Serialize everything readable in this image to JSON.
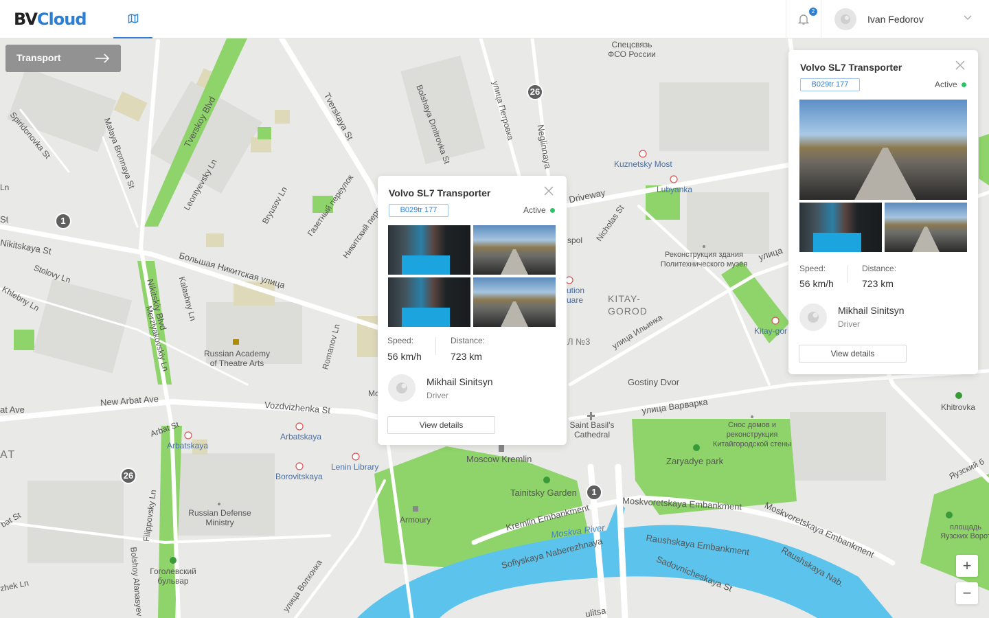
{
  "header": {
    "logo_bv": "BV",
    "logo_cloud": "Cloud",
    "notification_count": "2",
    "user_name": "Ivan Fedorov"
  },
  "transport_button": {
    "label": "Transport"
  },
  "clusters": [
    "26",
    "1",
    "26",
    "1"
  ],
  "map_labels": {
    "tverskoy": "Tverskoy Blvd",
    "tverskaya": "Tverskaya St",
    "bolshaya_dmitrovka": "Bolshaya Dmitrovka St",
    "petrovka": "улица Петровка",
    "neglinnaya": "Neglinnaya",
    "spidironovka": "Spiridonovka St",
    "malaya_bronnaya": "Malaya Bronnaya St",
    "leontyevsky": "Leontyevsky Ln",
    "bryusov": "Bryusov Ln",
    "gazetny": "Газетный переулок",
    "nikitsky_per": "Никитский переулок",
    "nikitskaya": "Nikitskaya St",
    "bolshaya_nikitskaya": "Большая Никитская улица",
    "stolovy": "Stolovy Ln",
    "khlebny": "Khlebny Ln",
    "nikitsky_blvd": "Nikitskiy Blvd",
    "kalashny": "Kalashny Ln",
    "merzlyakovsky": "Merzlyakovskiy Ln",
    "romanov": "Romanov Ln",
    "academy": "Russian Academy of Theatre Arts",
    "new_arbat": "New Arbat Ave",
    "arbat_ave": "at Ave",
    "vozdvizhenka": "Vozdvizhenka St",
    "arbat_st": "Arbat St",
    "arbatskaya1": "Arbatskaya",
    "arbatskaya2": "Arbatskaya",
    "borovitskaya": "Borovitskaya",
    "lenin_library": "Lenin Library",
    "defense": "Russian Defense Ministry",
    "filippovsky": "Filippovsky Ln",
    "gogolevsky": "Гоголевский бульвар",
    "bolshoy_afanasy": "Bolshoy Afanasyev",
    "volkhonka": "улица Волхонка",
    "spetssvyaz": "Спецсвязь ФСО России",
    "kuznetsky": "Kuznetsky Most",
    "lubyanka": "Lubyanka",
    "driveway": "Driveway",
    "nicholas": "Nicholas St",
    "ploshchad": "ution uare",
    "polytech": "Реконструкция здания Политехнического музея",
    "kitay_gorod": "KITAY-GOROD",
    "ilyinka": "улица Ильинка",
    "kitay_gor_station": "Kitay-gor",
    "gostiny": "Gostiny Dvor",
    "varvarka": "улица Варварка",
    "saint_basil": "Saint Basil's Cathedral",
    "snos": "Снос домов и реконструкция Китайгородской стены",
    "zaryadye": "Zaryadye park",
    "kremlin": "Moscow Kremlin",
    "tainitsky": "Tainitsky Garden",
    "armoury": "Armoury",
    "kremlin_emb": "Kremlin Embankment",
    "moskva_river": "Moskva River",
    "sofiyskaya": "Sofiyskaya Naberezhnaya",
    "moskvoretskaya": "Moskvoretskaya Embankment",
    "moskvoretskaya2": "Moskvoretskaya Embankment",
    "raushskaya": "Raushskaya Embankment",
    "raushskaya_nab": "Raushskaya Nab.",
    "sadovnicheskaya": "Sadovnicheskaya St",
    "khitrovka": "Khitrovka",
    "yauzskie": "площадь Яузских Ворот",
    "yauzsky": "Яузский б",
    "ulitsa": "улица",
    "st_left": "St",
    "ln_left": "Ln",
    "at_left": "AT",
    "zhek": "zhek Ln",
    "bat": "bat St",
    "mo": "Mo",
    "spol": "spol",
    "n3": "Л №3",
    "ulitsa_bottom": "ulitsa"
  },
  "popup_center": {
    "title": "Volvo SL7 Transporter",
    "plate": "B029tr 177",
    "status": "Active",
    "speed_label": "Speed:",
    "speed_value": "56 km/h",
    "distance_label": "Distance:",
    "distance_value": "723 km",
    "driver_name": "Mikhail Sinitsyn",
    "driver_role": "Driver",
    "button": "View details"
  },
  "popup_right": {
    "title": "Volvo SL7 Transporter",
    "plate": "B029tr 177",
    "status": "Active",
    "speed_label": "Speed:",
    "speed_value": "56 km/h",
    "distance_label": "Distance:",
    "distance_value": "723 km",
    "driver_name": "Mikhail Sinitsyn",
    "driver_role": "Driver",
    "button": "View details"
  },
  "zoom": {
    "in": "+",
    "out": "−"
  },
  "colors": {
    "accent": "#2a7fd6",
    "active": "#2fc26b",
    "water": "#5bc3ec",
    "park": "#8fd46a",
    "block": "#dcdcd9"
  }
}
